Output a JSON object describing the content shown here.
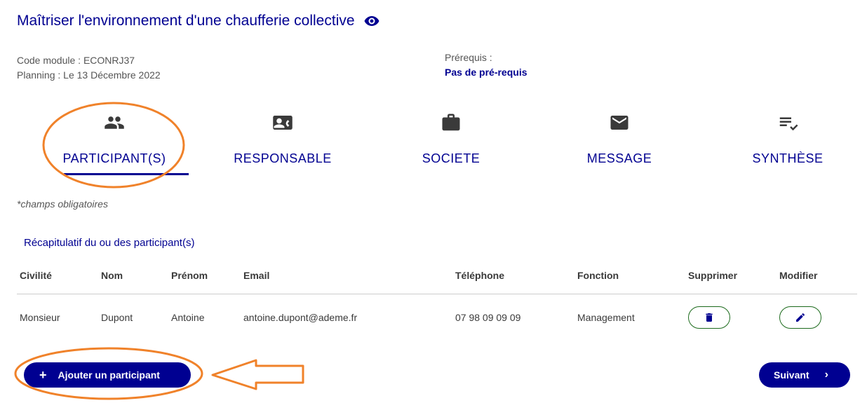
{
  "header": {
    "title": "Maîtriser l'environnement d'une chaufferie collective",
    "code_module": "Code module : ECONRJ37",
    "planning": "Planning : Le 13 Décembre 2022",
    "prereq_label": "Prérequis :",
    "prereq_value": "Pas de pré-requis"
  },
  "tabs": [
    {
      "label": "PARTICIPANT(S)",
      "icon": "group-icon",
      "active": true
    },
    {
      "label": "RESPONSABLE",
      "icon": "contact-card-icon",
      "active": false
    },
    {
      "label": "SOCIETE",
      "icon": "briefcase-icon",
      "active": false
    },
    {
      "label": "MESSAGE",
      "icon": "envelope-icon",
      "active": false
    },
    {
      "label": "SYNTHÈSE",
      "icon": "list-check-icon",
      "active": false
    }
  ],
  "form": {
    "required_note": "*champs obligatoires",
    "recap_title": "Récapitulatif du ou des participant(s)"
  },
  "table": {
    "columns": [
      "Civilité",
      "Nom",
      "Prénom",
      "Email",
      "Téléphone",
      "Fonction",
      "Supprimer",
      "Modifier"
    ],
    "rows": [
      {
        "civilite": "Monsieur",
        "nom": "Dupont",
        "prenom": "Antoine",
        "email": "antoine.dupont@ademe.fr",
        "telephone": "07 98 09 09 09",
        "fonction": "Management"
      }
    ]
  },
  "actions": {
    "add_label": "Ajouter un participant",
    "next_label": "Suivant"
  },
  "colors": {
    "primary": "#000091",
    "success_border": "#1b6a1b",
    "annotation": "#F0822A"
  }
}
